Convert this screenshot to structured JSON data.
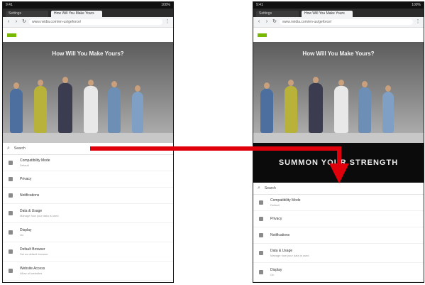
{
  "left_screen": {
    "status": {
      "left": "9:41",
      "right": "100%"
    },
    "tabs": [
      {
        "label": "Settings"
      },
      {
        "label": "How Will You Make Yours"
      }
    ],
    "url": "www.nvidia.com/en-us/geforce/",
    "hero_title": "How Will You Make Yours?",
    "search_label": "Search",
    "rows": [
      {
        "title": "Compatibility Mode",
        "subtitle": "Default"
      },
      {
        "title": "Privacy",
        "subtitle": ""
      },
      {
        "title": "Notifications",
        "subtitle": ""
      },
      {
        "title": "Data & Usage",
        "subtitle": "Manage how your data is used"
      },
      {
        "title": "Display",
        "subtitle": "On"
      },
      {
        "title": "Default Browser",
        "subtitle": "Set as default browser"
      },
      {
        "title": "Website Access",
        "subtitle": "Allow all websites"
      }
    ]
  },
  "right_screen": {
    "status": {
      "left": "9:41",
      "right": "100%"
    },
    "tabs": [
      {
        "label": "Settings"
      },
      {
        "label": "How Will You Make Yours"
      }
    ],
    "url": "www.nvidia.com/en-us/geforce/",
    "hero_title": "How Will You Make Yours?",
    "banner": "SUMMON YOUR STRENGTH",
    "search_label": "Search",
    "rows": [
      {
        "title": "Compatibility Mode",
        "subtitle": "Default"
      },
      {
        "title": "Privacy",
        "subtitle": ""
      },
      {
        "title": "Notifications",
        "subtitle": ""
      },
      {
        "title": "Data & Usage",
        "subtitle": "Manage how your data is used"
      },
      {
        "title": "Display",
        "subtitle": "On"
      }
    ]
  },
  "colors": {
    "arrow": "#e0000b",
    "brand": "#76b900",
    "banner_bg": "#0b0b0b"
  },
  "icons": [
    "back-icon",
    "forward-icon",
    "reload-icon",
    "search-icon",
    "more-icon",
    "arrow-annotation"
  ]
}
